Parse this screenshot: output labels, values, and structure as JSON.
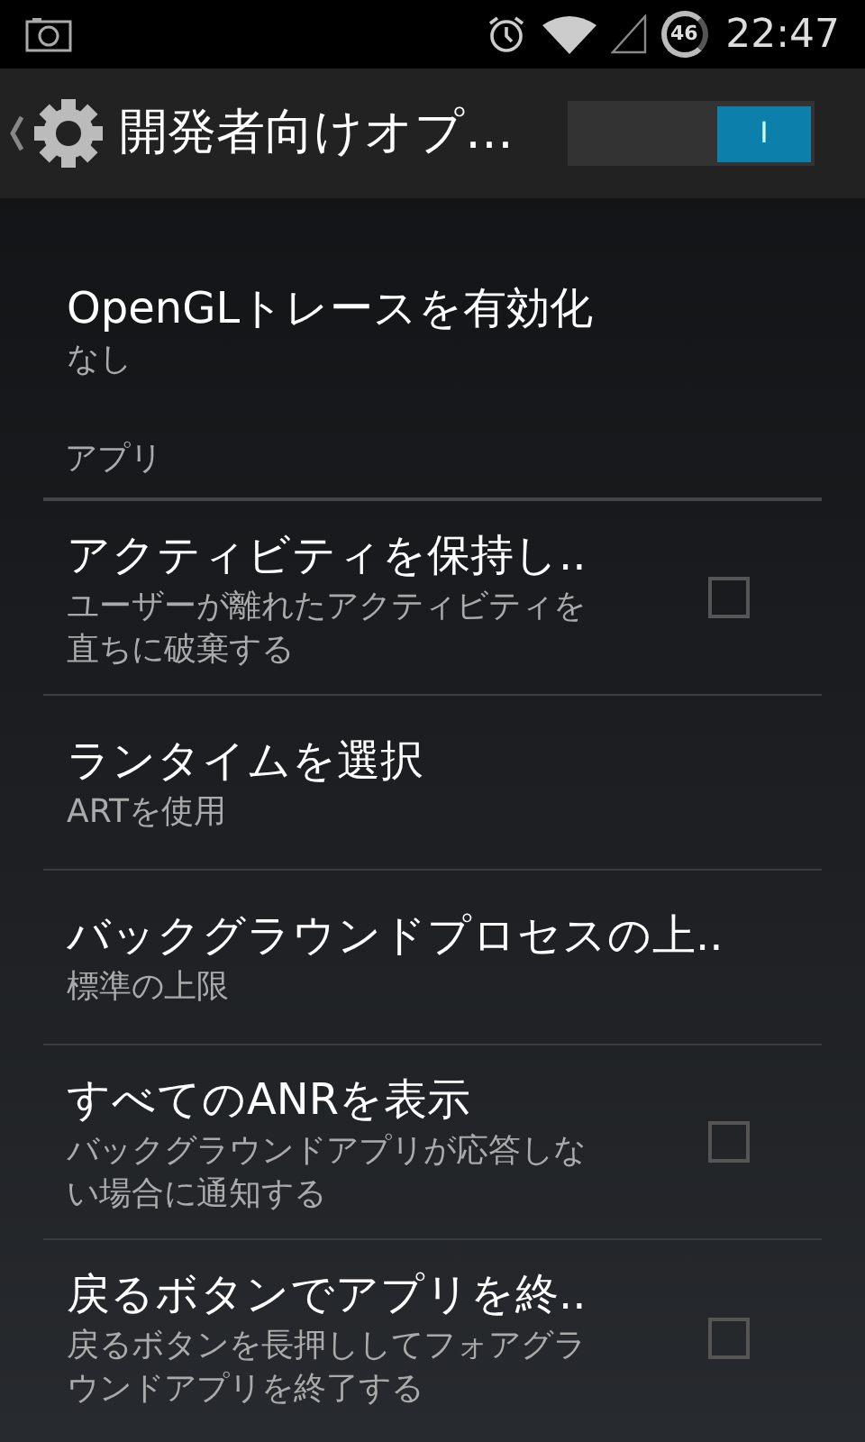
{
  "status_bar": {
    "battery": "46",
    "time": "22:47"
  },
  "action_bar": {
    "title": "開発者向けオプ…",
    "switch": {
      "on": true,
      "label": "I"
    }
  },
  "list": [
    {
      "kind": "item",
      "title": "OpenGLトレースを有効化",
      "summary": "なし"
    },
    {
      "kind": "category",
      "title": "アプリ"
    },
    {
      "kind": "checkbox",
      "title": "アクティビティを保持し..",
      "summary": "ユーザーが離れたアクティビティを直ちに破棄する",
      "checked": false
    },
    {
      "kind": "item",
      "title": "ランタイムを選択",
      "summary": "ARTを使用"
    },
    {
      "kind": "item",
      "title": "バックグラウンドプロセスの上..",
      "summary": "標準の上限"
    },
    {
      "kind": "checkbox",
      "title": "すべてのANRを表示",
      "summary": "バックグラウンドアプリが応答しない場合に通知する",
      "checked": false
    },
    {
      "kind": "checkbox",
      "title": "戻るボタンでアプリを終..",
      "summary": "戻るボタンを長押ししてフォアグラウンドアプリを終了する",
      "checked": false
    }
  ]
}
